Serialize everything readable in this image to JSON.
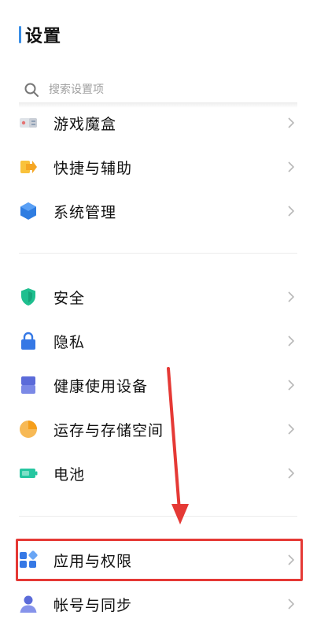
{
  "header": {
    "title": "设置"
  },
  "search": {
    "placeholder": "搜索设置项"
  },
  "groups": [
    {
      "items": [
        {
          "label": "游戏魔盒",
          "icon": "game-box-icon"
        },
        {
          "label": "快捷与辅助",
          "icon": "shortcut-icon"
        },
        {
          "label": "系统管理",
          "icon": "system-management-icon"
        }
      ]
    },
    {
      "items": [
        {
          "label": "安全",
          "icon": "shield-icon"
        },
        {
          "label": "隐私",
          "icon": "lock-icon"
        },
        {
          "label": "健康使用设备",
          "icon": "hourglass-icon"
        },
        {
          "label": "运存与存储空间",
          "icon": "storage-pie-icon"
        },
        {
          "label": "电池",
          "icon": "battery-icon"
        }
      ]
    },
    {
      "items": [
        {
          "label": "应用与权限",
          "icon": "apps-icon",
          "highlighted": true
        },
        {
          "label": "帐号与同步",
          "icon": "account-icon"
        }
      ]
    }
  ],
  "colors": {
    "accent": "#3a8ee6",
    "highlight": "#e53935",
    "arrow": "#e53935"
  }
}
